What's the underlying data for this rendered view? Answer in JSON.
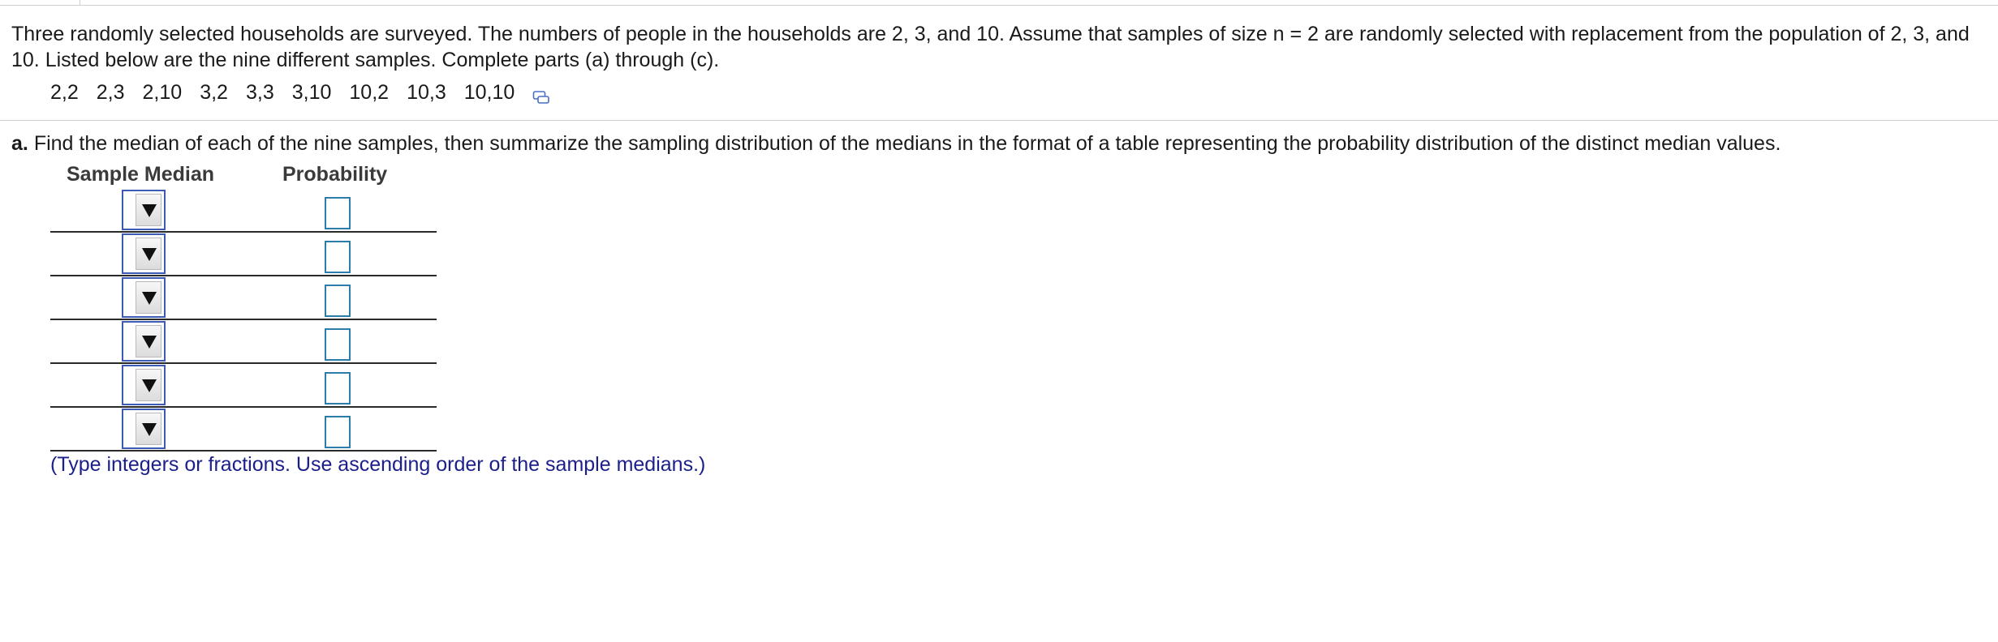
{
  "intro": "Three randomly selected households are surveyed. The numbers of people in the households are 2, 3, and 10. Assume that samples of size n = 2 are randomly selected with replacement from the population of 2, 3, and 10. Listed below are the nine different samples. Complete parts (a) through (c).",
  "samples": [
    "2,2",
    "2,3",
    "2,10",
    "3,2",
    "3,3",
    "3,10",
    "10,2",
    "10,3",
    "10,10"
  ],
  "copy_icon": "copy-to-clipboard-icon",
  "question": {
    "label": "a.",
    "text": "Find the median of each of the nine samples, then summarize the sampling distribution of the medians in the format of a table representing the probability distribution of the distinct median values."
  },
  "table": {
    "headers": {
      "median": "Sample Median",
      "probability": "Probability"
    },
    "rows": [
      {
        "median": "",
        "probability": ""
      },
      {
        "median": "",
        "probability": ""
      },
      {
        "median": "",
        "probability": ""
      },
      {
        "median": "",
        "probability": ""
      },
      {
        "median": "",
        "probability": ""
      },
      {
        "median": "",
        "probability": ""
      }
    ]
  },
  "hint": "(Type integers or fractions. Use ascending order of the sample medians.)",
  "colors": {
    "dropdown_border": "#3b5bb5",
    "input_border": "#2e7ca9",
    "hint_text": "#1b1f8a"
  }
}
